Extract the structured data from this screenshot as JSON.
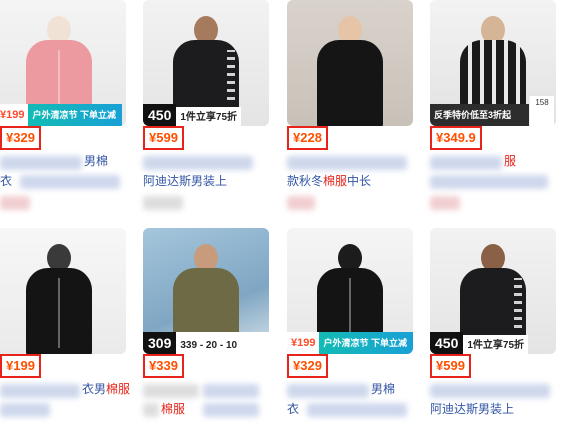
{
  "products": [
    {
      "price": "¥329",
      "banner": "户外清凉节 下单立减",
      "badge": "¥199",
      "title1": "男棉",
      "title2": "衣"
    },
    {
      "price": "¥599",
      "banner_num": "450",
      "banner": "1件立享75折",
      "title1": "",
      "title2": "阿迪达斯男装上"
    },
    {
      "price": "¥228",
      "title1": "",
      "title2": "款秋冬",
      "title2_hl": "棉服",
      "title2_tail": "中长"
    },
    {
      "price": "¥349.9",
      "banner": "反季特价低至3折起",
      "badge": "158",
      "title1_hl": "服",
      "title2": ""
    },
    {
      "price": "¥199",
      "title1": "衣男",
      "title1_hl": "棉服",
      "title2": ""
    },
    {
      "price": "¥339",
      "banner_num": "309",
      "banner": "339 - 20 - 10",
      "title1": "",
      "title2_hl": "棉服"
    },
    {
      "price": "¥329",
      "banner": "户外清凉节 下单立减",
      "badge": "¥199",
      "title1": "男棉",
      "title2": "衣"
    },
    {
      "price": "¥599",
      "banner_num": "450",
      "banner": "1件立享75折",
      "title1": "",
      "title2": "阿迪达斯男装上"
    }
  ],
  "colors": {
    "price_border": "#e8231a",
    "price_text": "#ff5000",
    "title_link": "#3255a4",
    "highlight": "#e8231a"
  }
}
